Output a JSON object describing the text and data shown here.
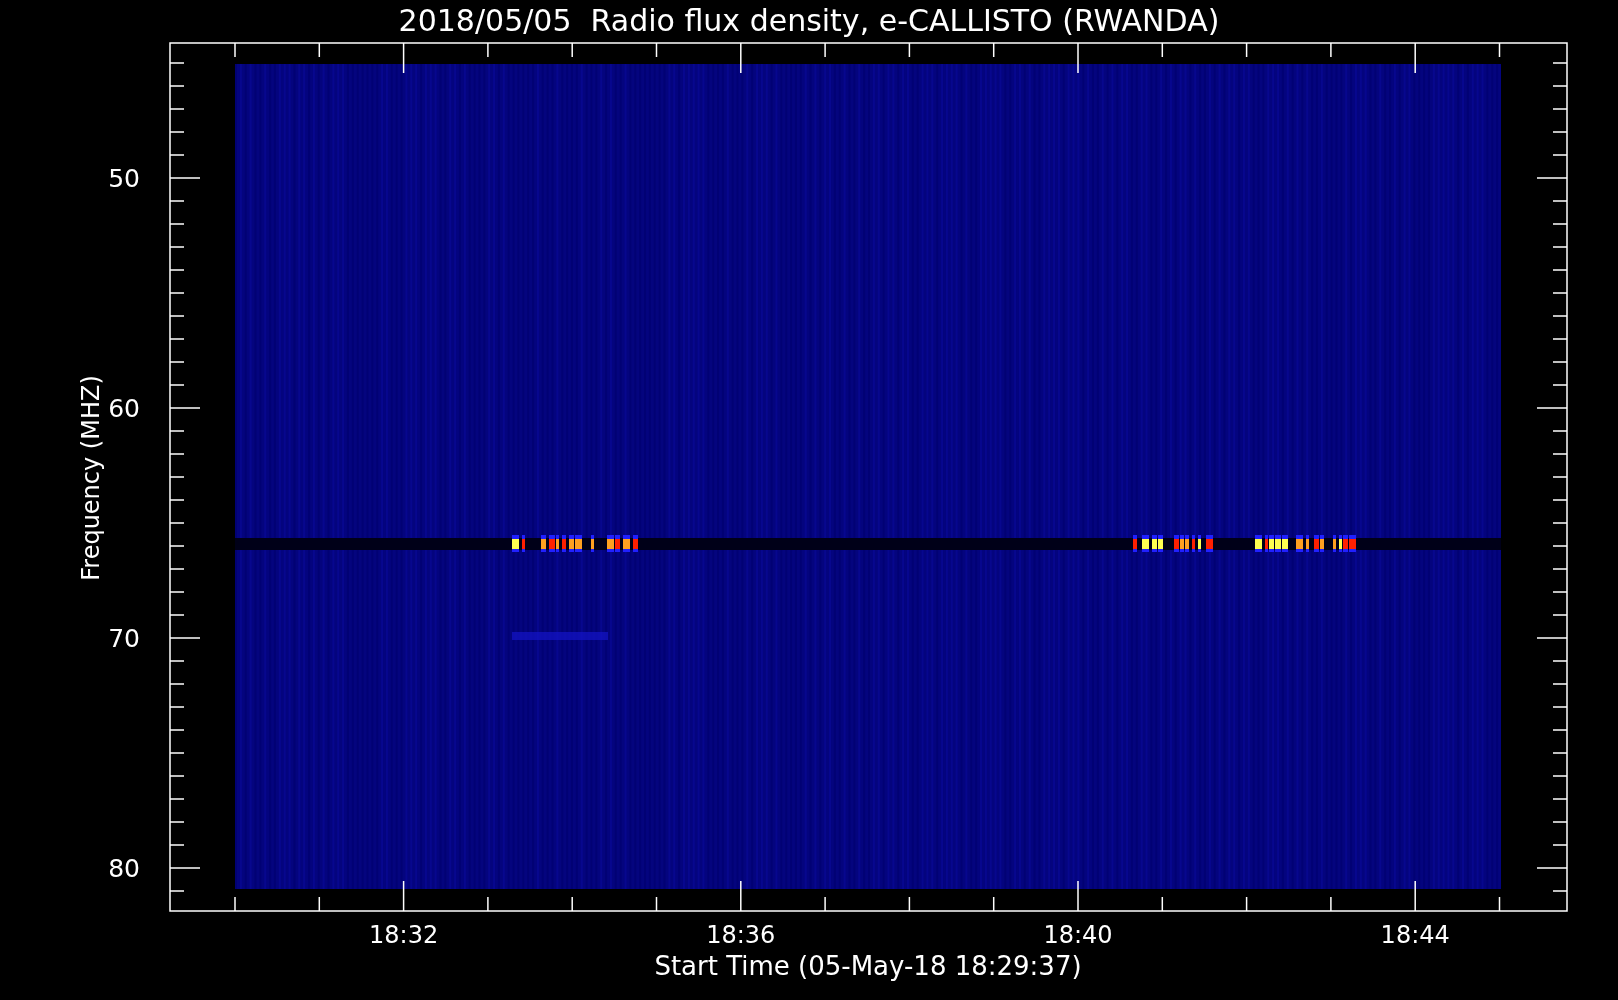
{
  "title": "2018/05/05  Radio flux density, e-CALLISTO (RWANDA)",
  "chart": {
    "xlabel": "Start Time (05-May-18 18:29:37)",
    "ylabel": "Frequency (MHZ)",
    "x_tick_labels": [
      "18:32",
      "18:36",
      "18:40",
      "18:44"
    ],
    "y_tick_labels": [
      "50",
      "60",
      "70",
      "80"
    ]
  }
}
